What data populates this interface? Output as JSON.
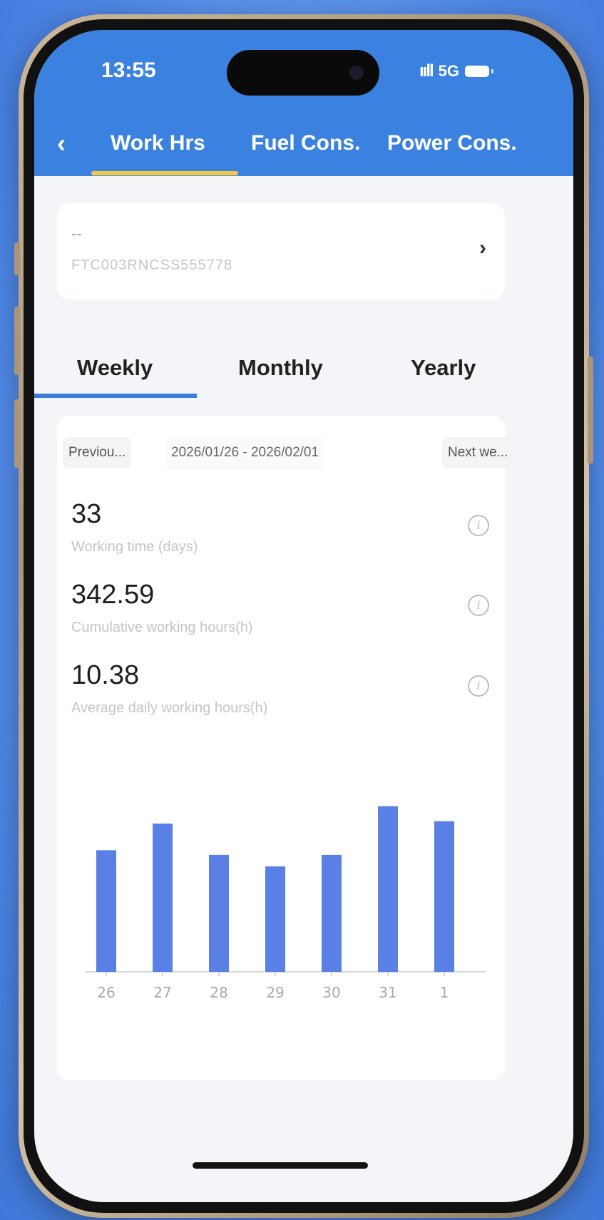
{
  "status_bar": {
    "time": "13:55",
    "signal": "ııll",
    "network": "5G"
  },
  "header": {
    "back_icon": "chevron-left-icon",
    "tabs": [
      {
        "label": "Work Hrs",
        "active": true
      },
      {
        "label": "Fuel Cons.",
        "active": false
      },
      {
        "label": "Power Cons.",
        "active": false
      }
    ]
  },
  "device": {
    "name": "--",
    "serial": "FTC003RNCSS555778"
  },
  "period_tabs": [
    {
      "label": "Weekly",
      "active": true
    },
    {
      "label": "Monthly",
      "active": false
    },
    {
      "label": "Yearly",
      "active": false
    }
  ],
  "week_nav": {
    "previous": "Previou...",
    "range": "2026/01/26 - 2026/02/01",
    "next": "Next we..."
  },
  "metrics": [
    {
      "value": "33",
      "label": "Working time (days)"
    },
    {
      "value": "342.59",
      "label": "Cumulative working hours(h)"
    },
    {
      "value": "10.38",
      "label": "Average daily working hours(h)"
    }
  ],
  "colors": {
    "header": "#3b82e0",
    "tab_underline": "#f2c84b",
    "period_underline": "#3b7ddd",
    "bar": "#5a80e6"
  },
  "chart_data": {
    "type": "bar",
    "categories": [
      "26",
      "27",
      "28",
      "29",
      "30",
      "31",
      "1"
    ],
    "values": [
      10.5,
      12.8,
      10.1,
      9.1,
      10.1,
      14.3,
      13.0
    ],
    "title": "",
    "xlabel": "",
    "ylabel": "",
    "ylim": [
      0,
      16
    ],
    "grid": false,
    "legend": "none"
  }
}
